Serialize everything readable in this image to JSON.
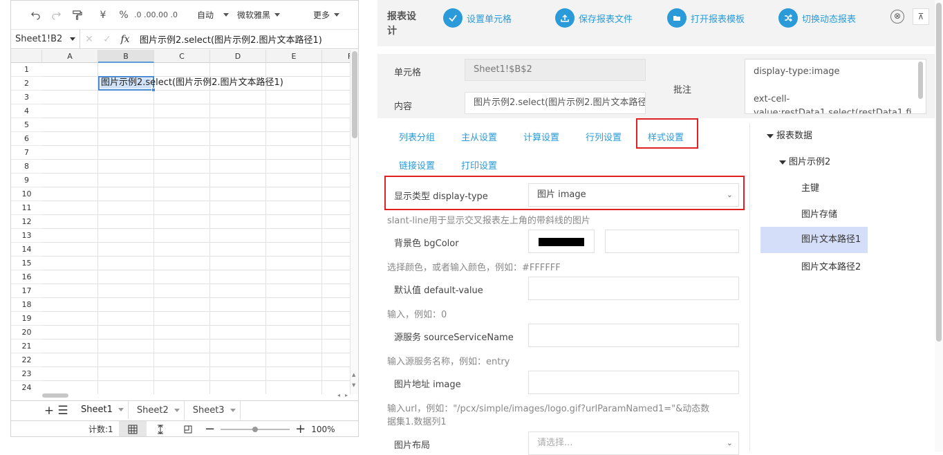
{
  "spreadsheet": {
    "toolbar": {
      "currency_label": "¥",
      "percent_label": "%",
      "decimal_inc_label": ".0 .00",
      "decimal_dec_label": ".00 .0",
      "format_value": "自动",
      "font_value": "微软雅黑",
      "more_label": "更多"
    },
    "name_box": "Sheet1!B2",
    "fx_label": "fx",
    "formula": "图片示例2.select(图片示例2.图片文本路径1)",
    "columns": [
      "A",
      "B",
      "C",
      "D",
      "E",
      "F"
    ],
    "rows": [
      "1",
      "2",
      "3",
      "4",
      "5",
      "6",
      "7",
      "8",
      "9",
      "10",
      "11",
      "12",
      "13",
      "14",
      "15",
      "16",
      "17",
      "18",
      "19",
      "20",
      "21",
      "22",
      "23",
      "24"
    ],
    "selected_cell_text": "图片示例2.select(图片示例2.图片文本路径1)",
    "sheet_tabs": [
      "Sheet1",
      "Sheet2",
      "Sheet3"
    ],
    "active_sheet": "Sheet1",
    "status_count": "计数:1",
    "zoom": "100%",
    "zoom_fraction": 0.5
  },
  "designer": {
    "title": "报表设计",
    "actions": [
      {
        "label": "设置单元格",
        "icon": "check-icon"
      },
      {
        "label": "保存报表文件",
        "icon": "upload-icon"
      },
      {
        "label": "打开报表模板",
        "icon": "folder-icon"
      },
      {
        "label": "切换动态报表",
        "icon": "shuffle-icon"
      }
    ],
    "close_label": "⊗",
    "pin_label": "⊼",
    "cell_label": "单元格",
    "cell_value": "Sheet1!$B$2",
    "content_label": "内容",
    "content_value": "图片示例2.select(图片示例2.图片文本路径1)",
    "remark_label": "批注",
    "remark_line1": "display-type:image",
    "remark_line2": "ext-cell-",
    "remark_line3": "value:restData1.select(restData1.fi",
    "tabs": [
      "列表分组",
      "主从设置",
      "计算设置",
      "行列设置",
      "样式设置",
      "链接设置",
      "打印设置"
    ],
    "active_tab": "样式设置",
    "form": {
      "display_type_label": "显示类型 display-type",
      "display_type_value": "图片 image",
      "display_type_hint": "slant-line用于显示交叉报表左上角的带斜线的图片",
      "bgcolor_label": "背景色 bgColor",
      "bgcolor_value": "#000000",
      "bgcolor_hint": "选择颜色，或者输入颜色，例如：#FFFFFF",
      "default_label": "默认值 default-value",
      "default_hint": "输入，例如：0",
      "source_label": "源服务 sourceServiceName",
      "source_hint": "输入源服务名称，例如：entry",
      "image_label": "图片地址 image",
      "image_hint1": "输入url，例如：\"/pcx/simple/images/logo.gif?urlParamNamed1=\"&动态数",
      "image_hint2": "据集1.数据列1",
      "layout_label": "图片布局",
      "layout_placeholder": "请选择..."
    },
    "tree": [
      {
        "label": "报表数据",
        "level": 0,
        "expanded": true
      },
      {
        "label": "图片示例2",
        "level": 1,
        "expanded": true
      },
      {
        "label": "主键",
        "level": 2
      },
      {
        "label": "图片存储",
        "level": 2
      },
      {
        "label": "图片文本路径1",
        "level": 2,
        "selected": true
      },
      {
        "label": "图片文本路径2",
        "level": 2
      }
    ],
    "colors": {
      "accent": "#2a9bd8",
      "highlight_red": "#e02020",
      "tree_selected": "#d5def8"
    }
  }
}
